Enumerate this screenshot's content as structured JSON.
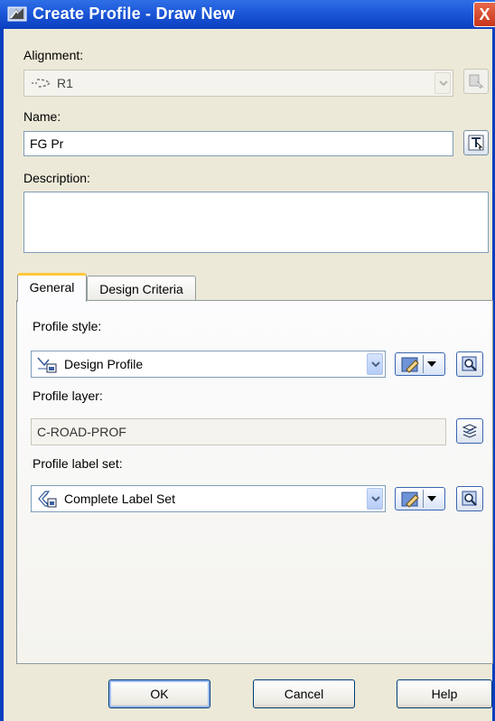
{
  "window": {
    "title": "Create Profile - Draw New",
    "close_label": "X"
  },
  "alignment": {
    "label": "Alignment:",
    "value": "R1"
  },
  "name": {
    "label": "Name:",
    "value": "FG Pr"
  },
  "description": {
    "label": "Description:",
    "value": ""
  },
  "tabs": [
    {
      "label": "General",
      "active": true
    },
    {
      "label": "Design Criteria",
      "active": false
    }
  ],
  "general": {
    "profile_style": {
      "label": "Profile style:",
      "value": "Design Profile"
    },
    "profile_layer": {
      "label": "Profile layer:",
      "value": "C-ROAD-PROF"
    },
    "profile_label_set": {
      "label": "Profile label set:",
      "value": "Complete Label Set"
    }
  },
  "buttons": {
    "ok": "OK",
    "cancel": "Cancel",
    "help": "Help"
  },
  "colors": {
    "titlebar": "#0A3FC0",
    "dialog_bg": "#ECE9D8",
    "active_tab_accent": "#FFC83C"
  },
  "icons": {
    "alignment": "alignment-icon",
    "pick_from_drawing": "pick-from-drawing-icon",
    "profile_style": "profile-style-icon",
    "label_set": "label-set-icon",
    "edit": "edit-style-icon",
    "preview": "preview-icon",
    "layer": "layer-icon"
  }
}
